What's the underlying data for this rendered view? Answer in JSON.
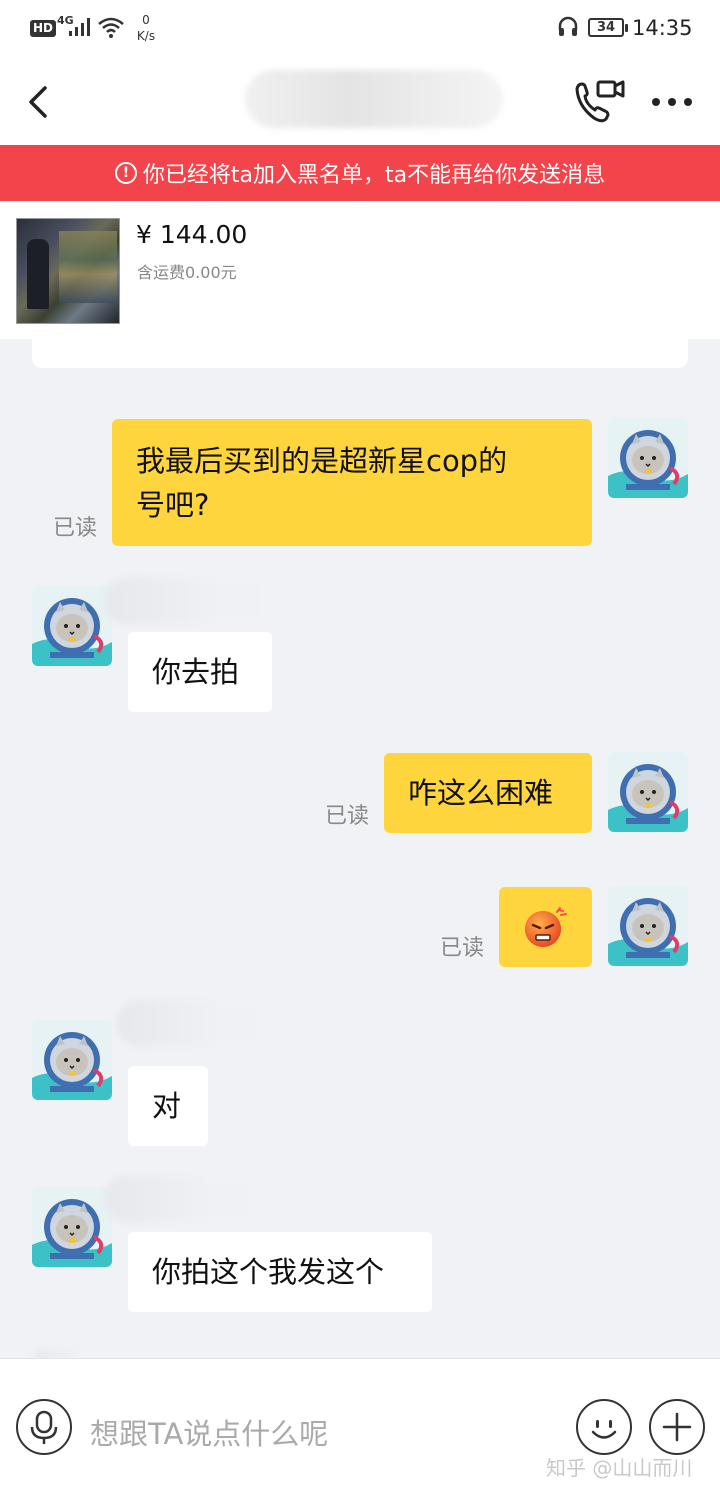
{
  "status_bar": {
    "hd": "HD",
    "network": "4G",
    "speed_value": "0",
    "speed_unit": "K/s",
    "battery": "34",
    "time": "14:35"
  },
  "banner": {
    "icon": "!",
    "text": "你已经将ta加入黑名单，ta不能再给你发送消息"
  },
  "product": {
    "price": "¥ 144.00",
    "shipping": "含运费0.00元"
  },
  "messages": [
    {
      "side": "out",
      "line1": "我最后买到的是超新星cop的",
      "line2": "号吧?",
      "status": "已读"
    },
    {
      "side": "in",
      "text": "你去拍"
    },
    {
      "side": "out",
      "text": "咋这么困难",
      "status": "已读"
    },
    {
      "side": "out",
      "emoji": "angry-face-emoji",
      "status": "已读"
    },
    {
      "side": "in",
      "text": "对"
    },
    {
      "side": "in",
      "text": "你拍这个我发这个"
    }
  ],
  "input": {
    "placeholder": "想跟TA说点什么呢"
  },
  "watermark": "知乎 @山山而川",
  "colors": {
    "banner": "#f4444b",
    "outgoing_bubble": "#ffd53e",
    "incoming_bubble": "#ffffff",
    "background": "#f1f2f6"
  }
}
